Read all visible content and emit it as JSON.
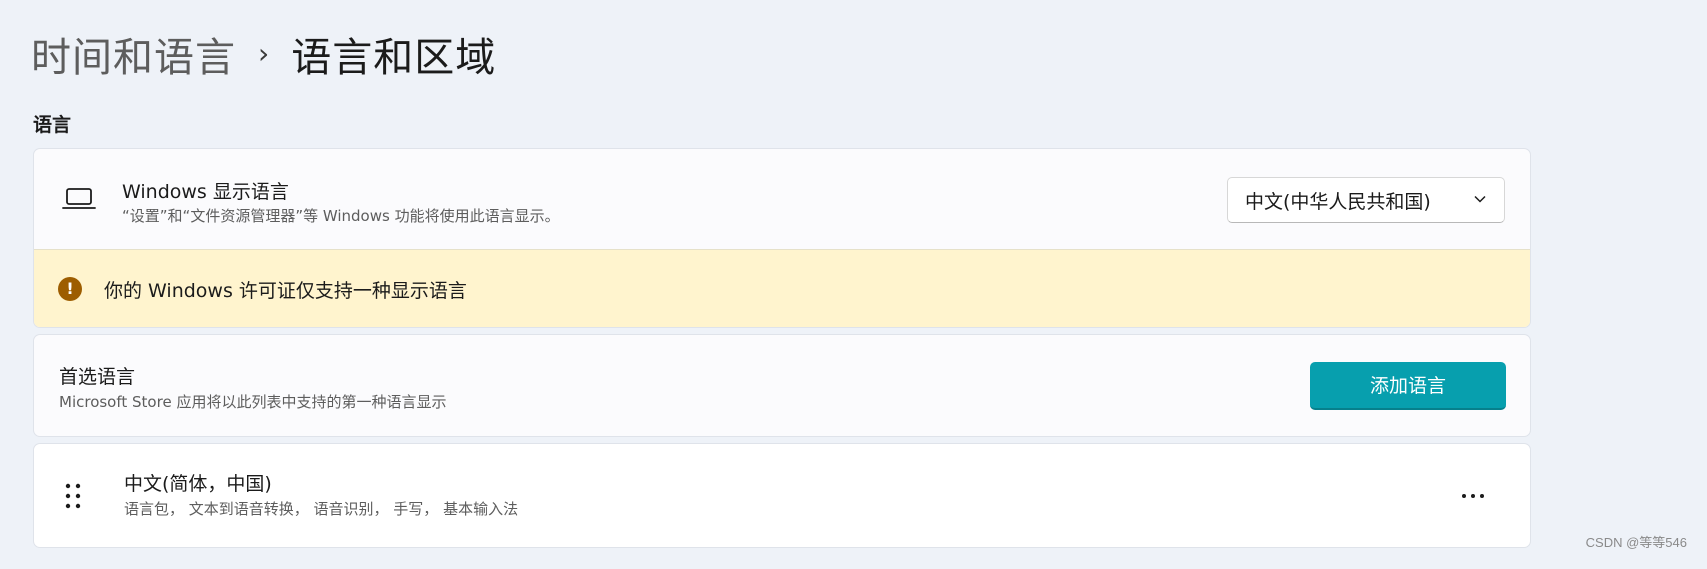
{
  "breadcrumb": {
    "parent": "时间和语言",
    "separator": "›",
    "current": "语言和区域"
  },
  "section": {
    "label": "语言"
  },
  "display_language": {
    "icon": "laptop-icon",
    "title": "Windows 显示语言",
    "description": "“设置”和“文件资源管理器”等 Windows 功能将使用此语言显示。",
    "selected": "中文(中华人民共和国)"
  },
  "warning": {
    "icon": "warning-icon",
    "glyph": "!",
    "text": "你的 Windows 许可证仅支持一种显示语言",
    "color": "#9d5d00"
  },
  "preferred": {
    "title": "首选语言",
    "description": "Microsoft Store 应用将以此列表中支持的第一种语言显示",
    "add_button": "添加语言",
    "accent": "#079fae"
  },
  "languages": [
    {
      "name": "中文(简体，中国)",
      "features": "语言包， 文本到语音转换， 语音识别， 手写， 基本输入法"
    }
  ],
  "watermark": "CSDN @等等546"
}
